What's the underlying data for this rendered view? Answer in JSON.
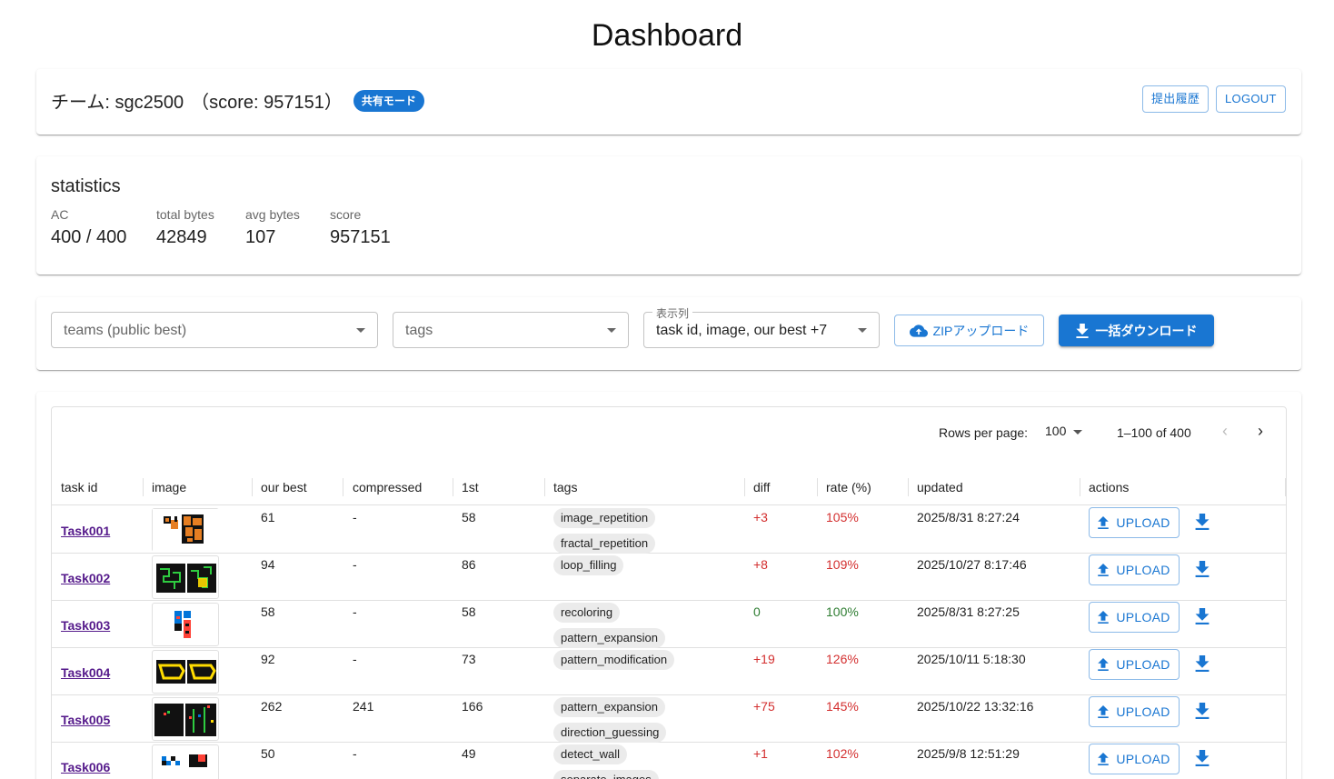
{
  "page": {
    "title": "Dashboard"
  },
  "team": {
    "label": "チーム: sgc2500",
    "score": "（score: 957151）",
    "mode_chip": "共有モード",
    "history_button": "提出履歴",
    "logout_button": "LOGOUT"
  },
  "statistics": {
    "title": "statistics",
    "items": [
      {
        "label": "AC",
        "value": "400 / 400"
      },
      {
        "label": "total bytes",
        "value": "42849"
      },
      {
        "label": "avg bytes",
        "value": "107"
      },
      {
        "label": "score",
        "value": "957151"
      }
    ]
  },
  "filters": {
    "teams_placeholder": "teams (public best)",
    "tags_placeholder": "tags",
    "columns_label": "表示列",
    "columns_value": "task id, image, our best +7",
    "zip_upload_button": "ZIPアップロード",
    "bulk_download_button": "一括ダウンロード"
  },
  "pagination": {
    "rows_per_page_label": "Rows per page:",
    "rows_per_page_value": "100",
    "range": "1–100 of 400"
  },
  "table": {
    "columns": [
      "task id",
      "image",
      "our best",
      "compressed",
      "1st",
      "tags",
      "diff",
      "rate (%)",
      "updated",
      "actions"
    ],
    "upload_label": "UPLOAD",
    "rows": [
      {
        "task": "Task001",
        "best": "61",
        "compressed": "-",
        "first": "58",
        "tags": [
          "image_repetition",
          "fractal_repetition"
        ],
        "diff": "+3",
        "rate": "105%",
        "updated": "2025/8/31 8:27:24",
        "status": "pos",
        "thumb": "orange"
      },
      {
        "task": "Task002",
        "best": "94",
        "compressed": "-",
        "first": "86",
        "tags": [
          "loop_filling"
        ],
        "diff": "+8",
        "rate": "109%",
        "updated": "2025/10/27 8:17:46",
        "status": "pos",
        "thumb": "green"
      },
      {
        "task": "Task003",
        "best": "58",
        "compressed": "-",
        "first": "58",
        "tags": [
          "recoloring",
          "pattern_expansion"
        ],
        "diff": "0",
        "rate": "100%",
        "updated": "2025/8/31 8:27:25",
        "status": "zero",
        "thumb": "bluered"
      },
      {
        "task": "Task004",
        "best": "92",
        "compressed": "-",
        "first": "73",
        "tags": [
          "pattern_modification"
        ],
        "diff": "+19",
        "rate": "126%",
        "updated": "2025/10/11 5:18:30",
        "status": "pos",
        "thumb": "yellow"
      },
      {
        "task": "Task005",
        "best": "262",
        "compressed": "241",
        "first": "166",
        "tags": [
          "pattern_expansion",
          "direction_guessing"
        ],
        "diff": "+75",
        "rate": "145%",
        "updated": "2025/10/22 13:32:16",
        "status": "pos",
        "thumb": "dark"
      },
      {
        "task": "Task006",
        "best": "50",
        "compressed": "-",
        "first": "49",
        "tags": [
          "detect_wall",
          "separate_images"
        ],
        "diff": "+1",
        "rate": "102%",
        "updated": "2025/9/8 12:51:29",
        "status": "pos",
        "thumb": "blue"
      }
    ]
  }
}
